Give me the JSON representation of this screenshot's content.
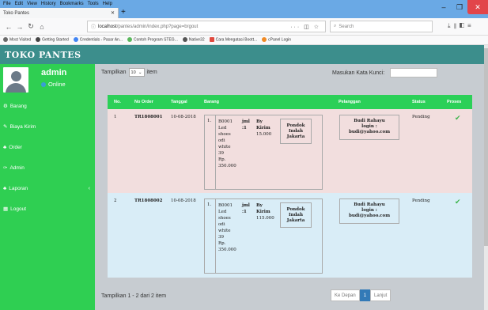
{
  "browser": {
    "menu": [
      "File",
      "Edit",
      "View",
      "History",
      "Bookmarks",
      "Tools",
      "Help"
    ],
    "tab_title": "Toko Pantes",
    "url_host": "localhost",
    "url_path": "/pantes/admin/index.php?page=brgout",
    "url_more": "···",
    "search_placeholder": "Search",
    "bookmarks": [
      "Most Visited",
      "Getting Started",
      "Credentials - Pasar An...",
      "Contoh Program STEG...",
      "Native32",
      "Cara Mengatasi Boott...",
      "cPanel Login"
    ]
  },
  "app": {
    "brand": "TOKO PANTES",
    "user": {
      "name": "admin",
      "status": "Online"
    },
    "sidebar": [
      {
        "label": "Barang",
        "icon": "box-icon"
      },
      {
        "label": "Biaya Kirim",
        "icon": "edit-icon"
      },
      {
        "label": "Order",
        "icon": "cart-icon"
      },
      {
        "label": "Admin",
        "icon": "wrench-icon"
      },
      {
        "label": "Laporan",
        "icon": "report-icon",
        "chevron": "‹"
      },
      {
        "label": "Logout",
        "icon": "grid-icon"
      }
    ]
  },
  "controls": {
    "show_prefix": "Tampilkan",
    "show_value": "10",
    "show_suffix": "item",
    "search_label": "Masukan Kata Kunci:"
  },
  "table": {
    "headers": [
      "No.",
      "No Order",
      "Tanggal",
      "Barang",
      "Pelanggan",
      "Status",
      "Proses"
    ],
    "rows": [
      {
        "no": "1",
        "order": "TR1808001",
        "date": "10-08-2018",
        "item_no": "1.",
        "item_name": [
          "B0001",
          "Led",
          "shoes",
          "odi",
          "white 39",
          "Rp.",
          "350.000"
        ],
        "jml": [
          "jml",
          ":1"
        ],
        "ongkir": [
          "By",
          "Kirim",
          "15.000"
        ],
        "address": [
          "Pondok",
          "Indah",
          "Jakarta"
        ],
        "buyer": [
          "Budi Rahayu",
          "login :",
          "budi@yahoo.com"
        ],
        "status": "Pending",
        "process": "✔"
      },
      {
        "no": "2",
        "order": "TR1808002",
        "date": "10-08-2018",
        "item_no": "1.",
        "item_name": [
          "B0001",
          "Led",
          "shoes",
          "odi",
          "white 39",
          "Rp.",
          "350.000"
        ],
        "jml": [
          "jml",
          ":1"
        ],
        "ongkir": [
          "By",
          "Kirim",
          "115.000"
        ],
        "address": [
          "Pondok",
          "Indah",
          "Jakarta"
        ],
        "buyer": [
          "Budi Rahayu",
          "login :",
          "budi@yahoo.com"
        ],
        "status": "Pending",
        "process": "✔"
      }
    ]
  },
  "footer": {
    "summary": "Tampilkan 1 - 2 dari 2 item",
    "prev": "Ke Depan",
    "page": "1",
    "next": "Lanjut"
  },
  "colors": {
    "accent_green": "#2bd058",
    "header_teal": "#3c8e8c",
    "row_pink": "#f2dede",
    "row_blue": "#d9edf7"
  }
}
